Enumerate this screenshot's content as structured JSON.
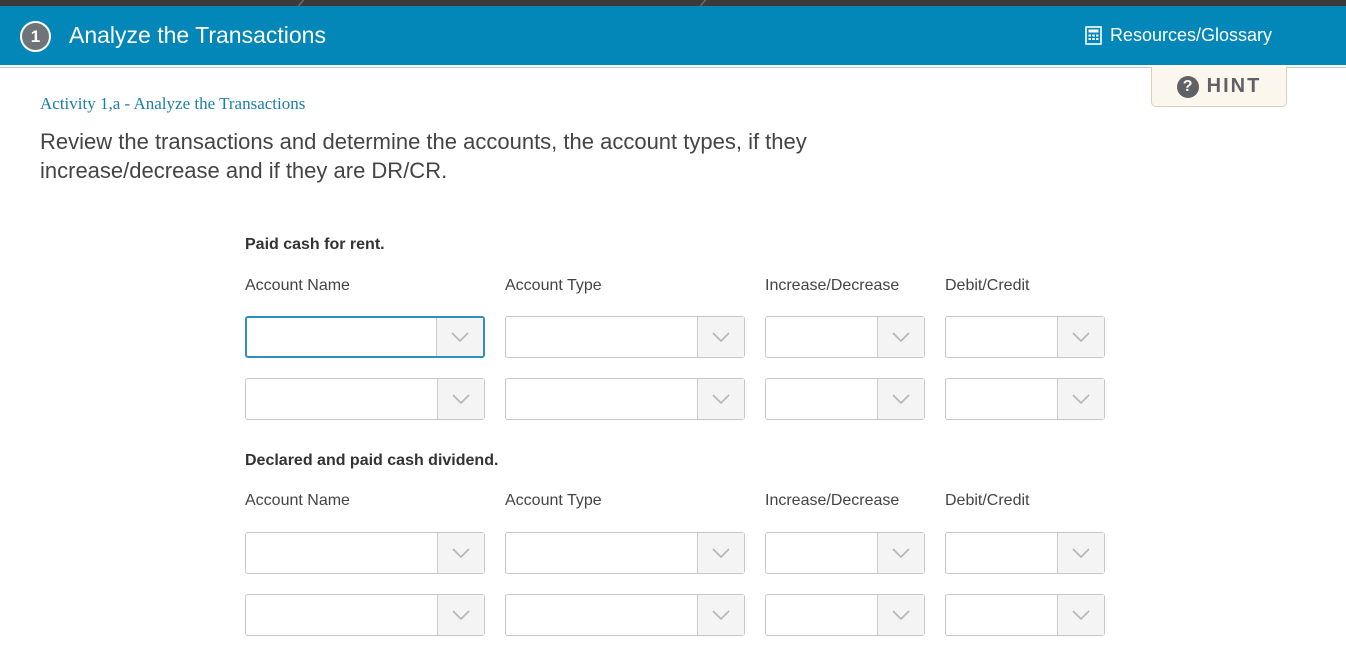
{
  "header": {
    "step_number": "1",
    "title": "Analyze the Transactions",
    "resources_label": "Resources/Glossary"
  },
  "hint": {
    "label": "HINT"
  },
  "activity": {
    "title": "Activity 1,a - Analyze the Transactions",
    "instructions": "Review the transactions and determine the accounts, the account types, if they increase/decrease and if they are DR/CR."
  },
  "columns": {
    "account_name": "Account Name",
    "account_type": "Account Type",
    "increase_decrease": "Increase/Decrease",
    "debit_credit": "Debit/Credit"
  },
  "transactions": [
    {
      "title": "Paid cash for rent.",
      "rows": [
        {
          "account_name": "",
          "account_type": "",
          "increase_decrease": "",
          "debit_credit": ""
        },
        {
          "account_name": "",
          "account_type": "",
          "increase_decrease": "",
          "debit_credit": ""
        }
      ]
    },
    {
      "title": "Declared and paid cash dividend.",
      "rows": [
        {
          "account_name": "",
          "account_type": "",
          "increase_decrease": "",
          "debit_credit": ""
        },
        {
          "account_name": "",
          "account_type": "",
          "increase_decrease": "",
          "debit_credit": ""
        }
      ]
    }
  ],
  "colors": {
    "header_bg": "#0387b8",
    "activity_title": "#1a7fa8",
    "focus_border": "#2e8fc0"
  }
}
